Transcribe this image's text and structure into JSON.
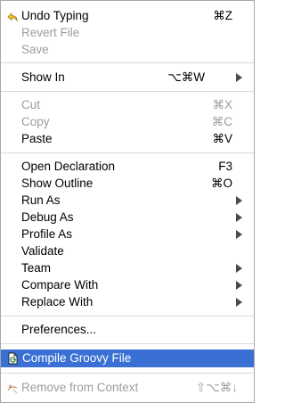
{
  "menu": {
    "undo": {
      "label": "Undo Typing",
      "shortcut": "⌘Z",
      "icon": "undo-arrow-icon"
    },
    "revert": {
      "label": "Revert File"
    },
    "save": {
      "label": "Save"
    },
    "show_in": {
      "label": "Show In",
      "shortcut": "⌥⌘W"
    },
    "cut": {
      "label": "Cut",
      "shortcut": "⌘X"
    },
    "copy": {
      "label": "Copy",
      "shortcut": "⌘C"
    },
    "paste": {
      "label": "Paste",
      "shortcut": "⌘V"
    },
    "open_declaration": {
      "label": "Open Declaration",
      "shortcut": "F3"
    },
    "show_outline": {
      "label": "Show Outline",
      "shortcut": "⌘O"
    },
    "run_as": {
      "label": "Run As"
    },
    "debug_as": {
      "label": "Debug As"
    },
    "profile_as": {
      "label": "Profile As"
    },
    "validate": {
      "label": "Validate"
    },
    "team": {
      "label": "Team"
    },
    "compare_with": {
      "label": "Compare With"
    },
    "replace_with": {
      "label": "Replace With"
    },
    "preferences": {
      "label": "Preferences..."
    },
    "compile_groovy": {
      "label": "Compile Groovy File",
      "icon": "groovy-file-icon"
    },
    "remove_context": {
      "label": "Remove from Context",
      "shortcut": "⇧⌥⌘↓",
      "icon": "remove-context-icon"
    }
  },
  "colors": {
    "highlight": "#3a70d4",
    "disabled_text": "#9c9c9c",
    "separator": "#d9d9d9"
  }
}
